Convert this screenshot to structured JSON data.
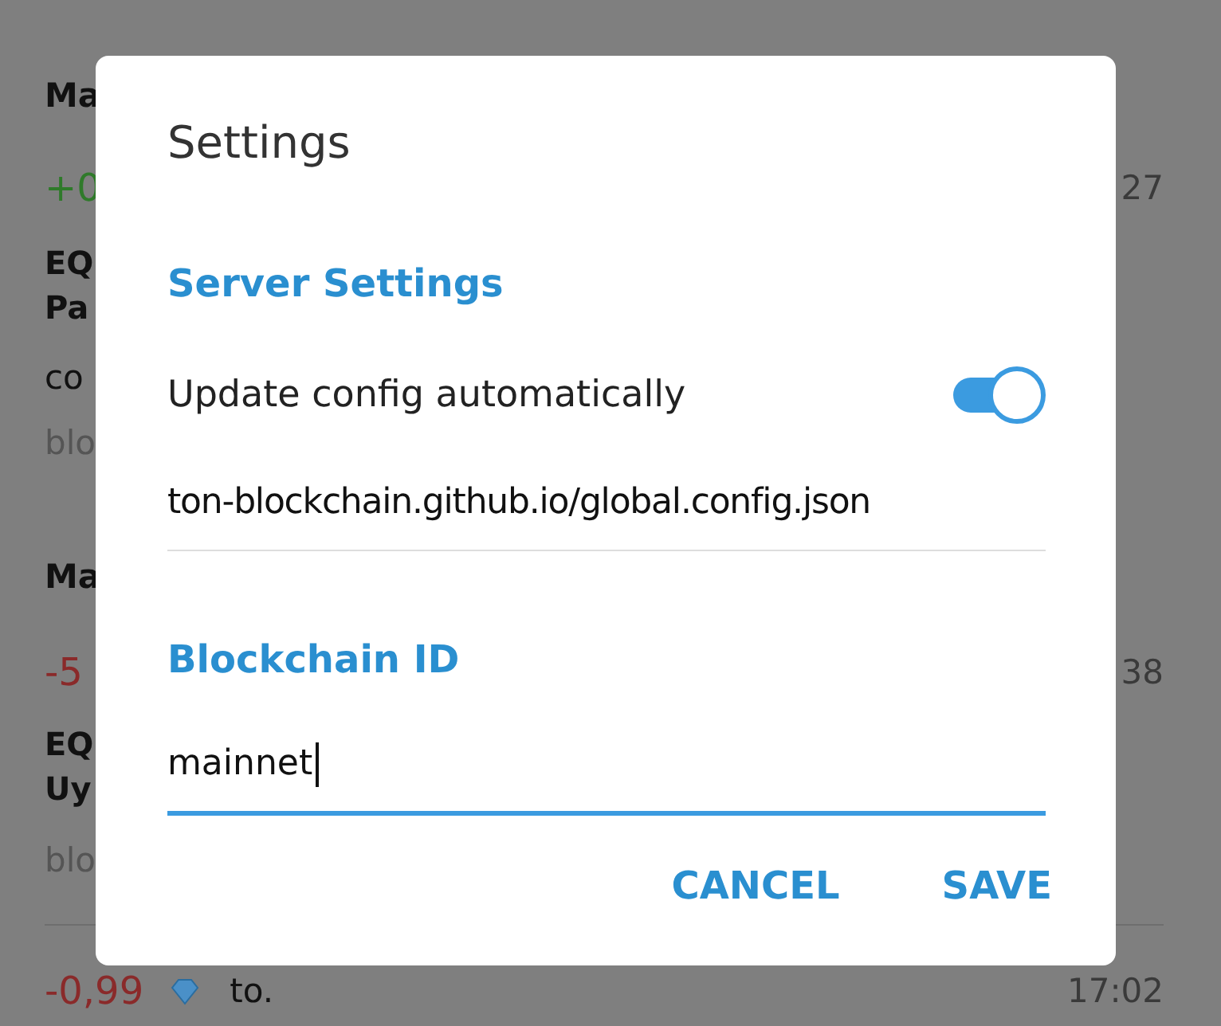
{
  "transactions": [
    {
      "kind": "full",
      "title": "Ma",
      "amount": "+0",
      "color": "#2f7a2a",
      "time": "27",
      "address": [
        "EQ",
        "Pa"
      ],
      "comment": "co",
      "meta": "blo"
    },
    {
      "kind": "full",
      "title": "Ma",
      "amount": "-5",
      "color": "#8a2a2a",
      "time": "38",
      "address": [
        "EQ",
        "Uy"
      ],
      "meta": "blo"
    },
    {
      "kind": "compact",
      "amount": "-0,99",
      "color": "#8a2a2a",
      "comment": "to.",
      "time": "17:02"
    }
  ],
  "dialog": {
    "title": "Settings",
    "server_settings": {
      "heading": "Server Settings",
      "toggle": {
        "label": "Update config automatically",
        "on": true
      },
      "config_url": "ton-blockchain.github.io/global.config.json"
    },
    "blockchain": {
      "heading": "Blockchain ID",
      "value": "mainnet",
      "focused": true
    },
    "buttons": [
      "CANCEL",
      "SAVE"
    ]
  }
}
